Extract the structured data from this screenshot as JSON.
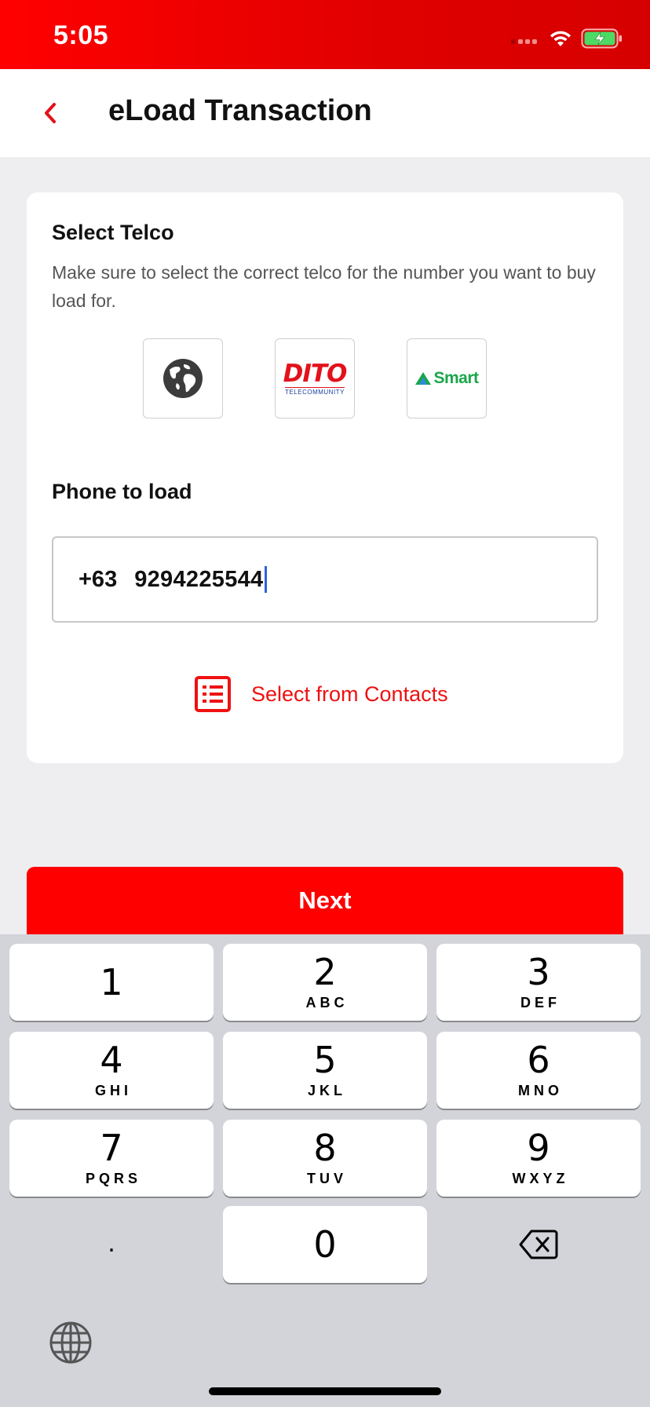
{
  "status_bar": {
    "time": "5:05"
  },
  "header": {
    "title": "eLoad Transaction"
  },
  "select_telco": {
    "title": "Select Telco",
    "helper": "Make sure to select the correct telco for the number you want to buy load for.",
    "options": [
      {
        "icon": "globe-icon"
      },
      {
        "logo_text": "DITO",
        "logo_subtext": "TELECOMMUNITY"
      },
      {
        "logo_text": "Smart"
      }
    ]
  },
  "phone": {
    "title": "Phone to load",
    "country_code": "+63",
    "number": "9294225544"
  },
  "contacts": {
    "label": "Select from Contacts"
  },
  "next": {
    "label": "Next"
  },
  "keyboard": {
    "keys": [
      {
        "digit": "1",
        "letters": ""
      },
      {
        "digit": "2",
        "letters": "ABC"
      },
      {
        "digit": "3",
        "letters": "DEF"
      },
      {
        "digit": "4",
        "letters": "GHI"
      },
      {
        "digit": "5",
        "letters": "JKL"
      },
      {
        "digit": "6",
        "letters": "MNO"
      },
      {
        "digit": "7",
        "letters": "PQRS"
      },
      {
        "digit": "8",
        "letters": "TUV"
      },
      {
        "digit": "9",
        "letters": "WXYZ"
      },
      {
        "digit": ".",
        "letters": ""
      },
      {
        "digit": "0",
        "letters": ""
      }
    ]
  },
  "colors": {
    "brand_red": "#ff0000",
    "link_red": "#ee1111",
    "caret_blue": "#2c62d6"
  }
}
